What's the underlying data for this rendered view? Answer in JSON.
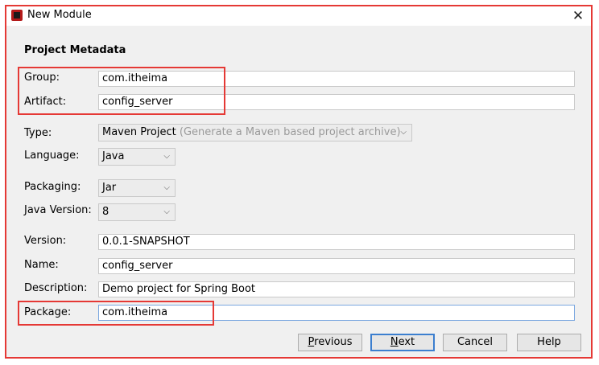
{
  "window": {
    "title": "New Module",
    "close_glyph": "✕"
  },
  "form": {
    "section_title": "Project Metadata",
    "group": {
      "label": "Group:",
      "value": "com.itheima"
    },
    "artifact": {
      "label": "Artifact:",
      "value": "config_server"
    },
    "type": {
      "label": "Type:",
      "value": "Maven Project",
      "hint": "(Generate a Maven based project archive)"
    },
    "language": {
      "label": "Language:",
      "value": "Java"
    },
    "packaging": {
      "label": "Packaging:",
      "value": "Jar"
    },
    "java_version": {
      "label": "Java Version:",
      "value": "8"
    },
    "version": {
      "label": "Version:",
      "value": "0.0.1-SNAPSHOT"
    },
    "name": {
      "label": "Name:",
      "value": "config_server"
    },
    "description": {
      "label": "Description:",
      "value": "Demo project for Spring Boot"
    },
    "package": {
      "label": "Package:",
      "value": "com.itheima"
    }
  },
  "buttons": {
    "previous": {
      "mnemonic": "P",
      "rest": "revious"
    },
    "next": {
      "mnemonic": "N",
      "rest": "ext"
    },
    "cancel": "Cancel",
    "help": "Help"
  },
  "icons": {
    "app": "intellij-idea-icon",
    "dropdown": "chevron-down-icon",
    "close": "close-icon"
  },
  "colors": {
    "highlight_border": "#e53935",
    "primary_button_border": "#3c7fcf",
    "dialog_bg": "#f0f0f0"
  }
}
